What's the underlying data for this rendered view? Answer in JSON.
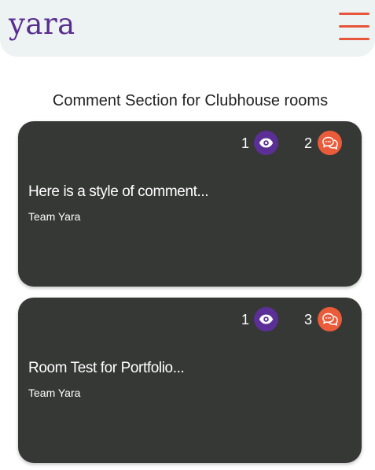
{
  "header": {
    "logo_text": "yara",
    "menu_icon": "hamburger-menu-icon",
    "accent_color": "#e8553a",
    "brand_color": "#5a2d91"
  },
  "main": {
    "title": "Comment Section for Clubhouse rooms",
    "cards": [
      {
        "views": "1",
        "comments": "2",
        "title": "Here is a style of comment...",
        "author": "Team Yara"
      },
      {
        "views": "1",
        "comments": "3",
        "title": "Room Test for Portfolio...",
        "author": "Team Yara"
      }
    ],
    "view_icon": "eye-icon",
    "comment_icon": "chat-bubbles-icon"
  }
}
